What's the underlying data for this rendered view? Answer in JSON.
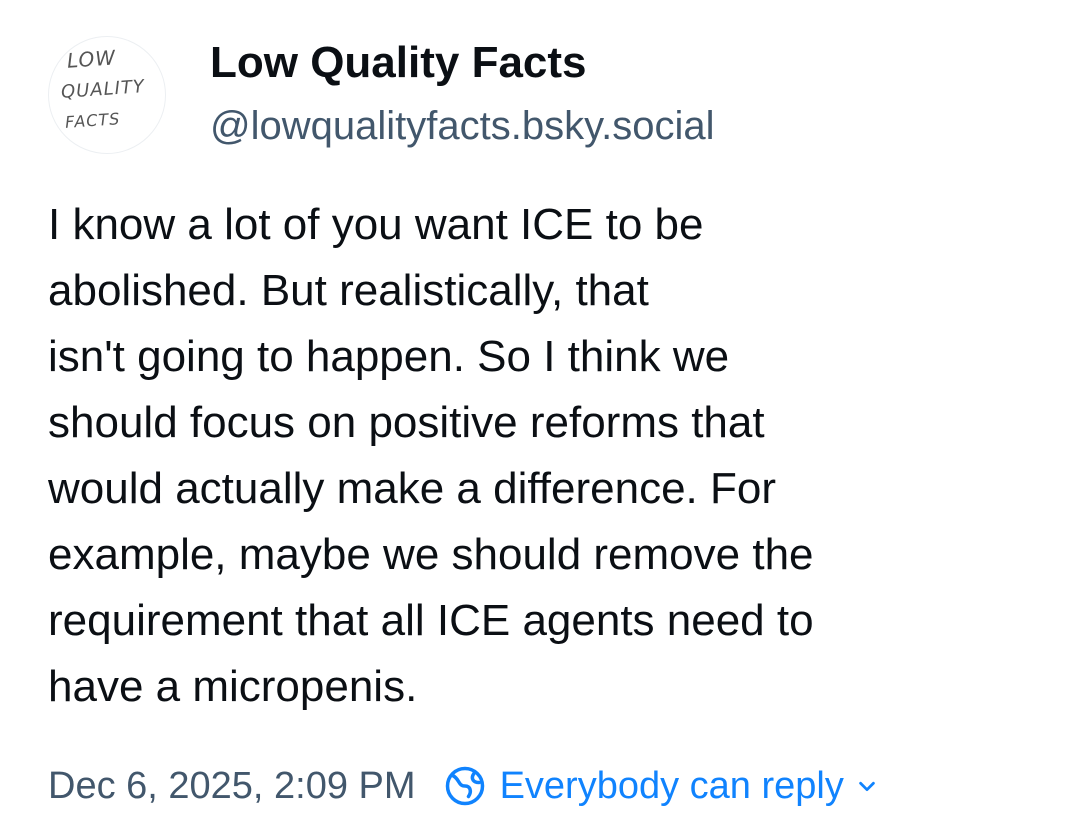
{
  "author": {
    "display_name": "Low Quality Facts",
    "handle": "@lowqualityfacts.bsky.social",
    "avatar_lines": [
      "LOW",
      "QUALITY",
      "FACTS"
    ]
  },
  "post": {
    "text_lines": [
      "I know a lot of you want ICE to be",
      "abolished. But realistically, that",
      "isn't going to happen. So I think we",
      "should focus on positive reforms that",
      "would actually make a difference. For",
      "example, maybe we should remove the",
      "requirement that all ICE agents need to",
      "have a micropenis."
    ],
    "timestamp": "Dec 6, 2025, 2:09 PM",
    "reply_setting": "Everybody can reply"
  },
  "icons": {
    "reply_setting": "globe-icon",
    "reply_dropdown": "chevron-down-icon"
  },
  "colors": {
    "text": "#0b0f14",
    "muted": "#42576c",
    "accent": "#1083fe"
  }
}
